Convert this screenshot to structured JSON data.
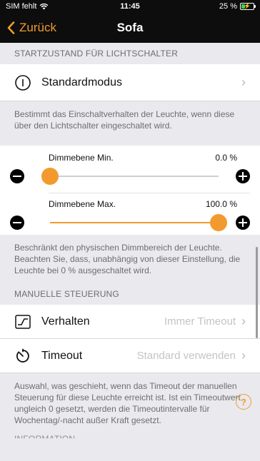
{
  "status_bar": {
    "carrier": "SIM fehlt",
    "time": "11:45",
    "battery": "25 %",
    "battery_level": 0.25
  },
  "nav": {
    "back_label": "Zurück",
    "title": "Sofa"
  },
  "light_switch": {
    "header": "STARTZUSTAND FÜR LICHTSCHALTER",
    "mode_label": "Standardmodus",
    "footer": "Bestimmt das Einschaltverhalten der Leuchte, wenn diese über den Lichtschalter eingeschaltet wird."
  },
  "dim": {
    "min_label": "Dimmebene Min.",
    "min_value": "0.0 %",
    "min_fraction": 0.0,
    "max_label": "Dimmebene Max.",
    "max_value": "100.0 %",
    "max_fraction": 1.0,
    "footer": "Beschränkt den physischen Dimmbereich der Leuchte. Beachten Sie, dass, unabhängig von dieser Einstellung, die Leuchte bei 0 % ausgeschaltet wird."
  },
  "manual": {
    "header": "MANUELLE STEUERUNG",
    "behavior_label": "Verhalten",
    "behavior_value": "Immer Timeout",
    "timeout_label": "Timeout",
    "timeout_value": "Standard verwenden",
    "footer": "Auswahl, was geschieht, wenn das Timeout der manuellen Steuerung für diese Leuchte erreicht ist. Ist ein Timeoutwert ungleich 0 gesetzt, werden die Timeoutintervalle für Wochentag/-nacht außer Kraft gesetzt."
  },
  "next_section_header": "INFORMATION",
  "help_label": "?",
  "colors": {
    "accent": "#f29a2e",
    "navbar": "#0d0d0d",
    "background": "#e9e9ee"
  },
  "icons": [
    "wifi-icon",
    "battery-icon",
    "chevron-left-icon",
    "power-icon",
    "chevron-right-icon",
    "minus-icon",
    "plus-icon",
    "behavior-curve-icon",
    "timer-icon",
    "help-icon"
  ]
}
